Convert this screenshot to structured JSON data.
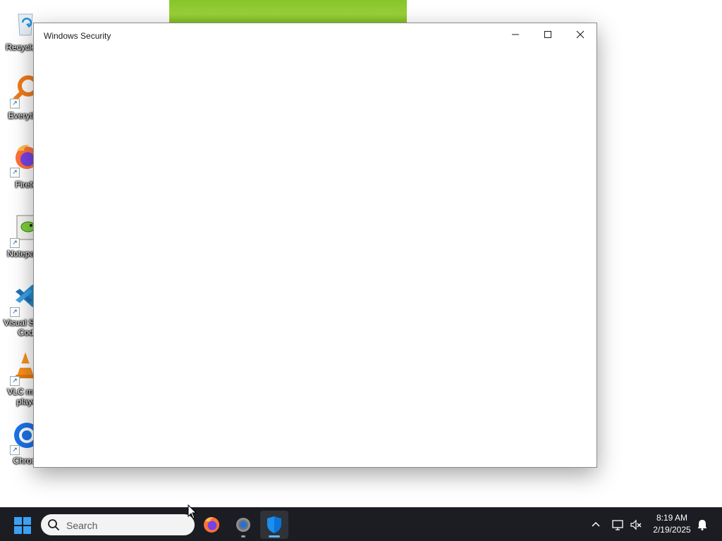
{
  "desktop": {
    "icons": [
      {
        "name": "recycle-bin",
        "label": "Recycle Bin"
      },
      {
        "name": "everything",
        "label": "Everything"
      },
      {
        "name": "firefox",
        "label": "Firefox"
      },
      {
        "name": "notepad-plus-plus",
        "label": "Notepad++"
      },
      {
        "name": "visual-studio-code",
        "label": "Visual Studio Code"
      },
      {
        "name": "vlc",
        "label": "VLC media player"
      },
      {
        "name": "chrome",
        "label": "Chrome"
      }
    ]
  },
  "window": {
    "title": "Windows Security",
    "controls": {
      "minimize": "minimize-icon",
      "maximize": "maximize-icon",
      "close": "close-icon"
    }
  },
  "taskbar": {
    "start_icon": "windows-start-icon",
    "search": {
      "placeholder": "Search",
      "value": ""
    },
    "apps": [
      {
        "name": "firefox",
        "icon": "firefox-icon",
        "running": false
      },
      {
        "name": "settings",
        "icon": "gear-icon",
        "running": true
      },
      {
        "name": "windows-security",
        "icon": "shield-icon",
        "running": true,
        "active": true
      }
    ],
    "tray": {
      "overflow_icon": "chevron-up-icon",
      "network_icon": "network-icon",
      "volume_icon": "volume-muted-icon",
      "notification_icon": "bell-icon"
    },
    "clock": {
      "time": "8:19 AM",
      "date": "2/19/2025"
    }
  },
  "colors": {
    "taskbar_bg": "#1b1d22",
    "accent": "#0078d4",
    "window_bg": "#ffffff"
  }
}
